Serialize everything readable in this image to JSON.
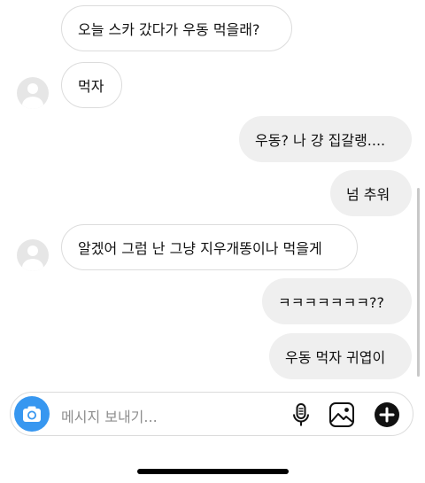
{
  "messages": [
    {
      "side": "in",
      "text": "오늘 스카 갔다가 우동 먹을래?"
    },
    {
      "side": "in",
      "text": "먹자"
    },
    {
      "side": "out",
      "text": "우동? 나 걍 집갈랭...."
    },
    {
      "side": "out",
      "text": "넘 추워"
    },
    {
      "side": "in",
      "text": "알겠어 그럼 난 그냥 지우개똥이나 먹을게"
    },
    {
      "side": "out",
      "text": "ㅋㅋㅋㅋㅋㅋㅋ??"
    },
    {
      "side": "out",
      "text": "우동 먹자 귀엽이"
    }
  ],
  "composer": {
    "placeholder": "메시지 보내기...",
    "icons": [
      "camera-icon",
      "microphone-icon",
      "gallery-icon",
      "plus-icon"
    ],
    "accent": "#3797f0"
  },
  "colors": {
    "incoming_bubble": "#ffffff",
    "outgoing_bubble": "#efefef",
    "bubble_border": "#dcdcdc"
  }
}
